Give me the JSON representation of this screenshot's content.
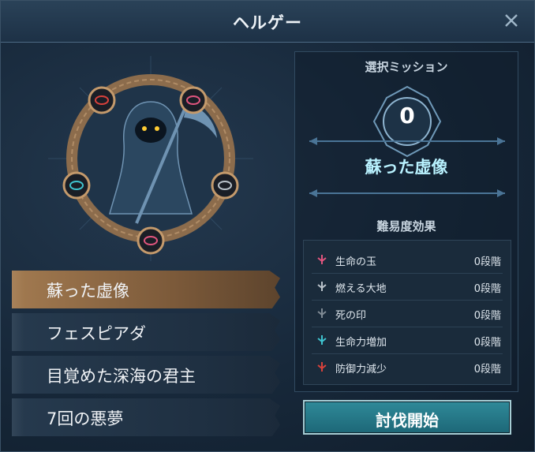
{
  "window": {
    "title": "ヘルゲー"
  },
  "missions": [
    {
      "label": "蘇った虚像",
      "selected": true
    },
    {
      "label": "フェスピアダ",
      "selected": false
    },
    {
      "label": "目覚めた深海の君主",
      "selected": false
    },
    {
      "label": "7回の悪夢",
      "selected": false
    }
  ],
  "panel": {
    "header": "選択ミッション",
    "count": "0",
    "mission_name": "蘇った虚像",
    "difficulty_header": "難易度効果",
    "effects": [
      {
        "name": "生命の玉",
        "level": "0段階",
        "icon": "pink-rune-icon",
        "color": "#e0557e"
      },
      {
        "name": "燃える大地",
        "level": "0段階",
        "icon": "grey-rune-icon",
        "color": "#b9c2ca"
      },
      {
        "name": "死の印",
        "level": "0段階",
        "icon": "dark-rune-icon",
        "color": "#7f8a94"
      },
      {
        "name": "生命力増加",
        "level": "0段階",
        "icon": "teal-rune-icon",
        "color": "#3fc3cf"
      },
      {
        "name": "防御力減少",
        "level": "0段階",
        "icon": "red-rune-icon",
        "color": "#d8413b"
      }
    ]
  },
  "start_button": {
    "label": "討伐開始"
  },
  "colors": {
    "accent": "#2f8a99",
    "selected": "#a27a50",
    "highlight_text": "#b9f2ff"
  }
}
